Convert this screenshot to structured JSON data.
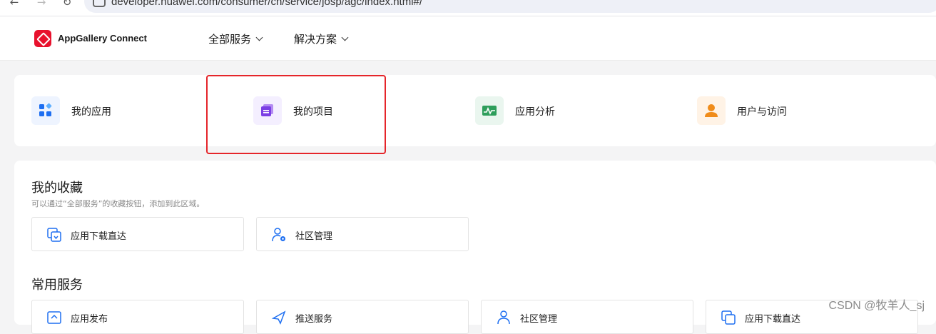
{
  "browser": {
    "back_glyph": "←",
    "forward_glyph": "→",
    "reload_glyph": "↻",
    "url": "developer.huawei.com/consumer/cn/service/josp/agc/index.html#/"
  },
  "header": {
    "brand": "AppGallery Connect",
    "nav": [
      {
        "label": "全部服务"
      },
      {
        "label": "解决方案"
      }
    ]
  },
  "quick_links": [
    {
      "label": "我的应用",
      "icon": "apps-grid-icon",
      "color": "#1e6ff1",
      "bg": "#eef4ff"
    },
    {
      "label": "我的项目",
      "icon": "project-stack-icon",
      "color": "#7b3fe4",
      "bg": "#f4efff"
    },
    {
      "label": "应用分析",
      "icon": "analytics-chart-icon",
      "color": "#2e9e5b",
      "bg": "#eaf6ef"
    },
    {
      "label": "用户与访问",
      "icon": "user-person-icon",
      "color": "#f08c1a",
      "bg": "#fff3e6"
    }
  ],
  "favorites": {
    "title": "我的收藏",
    "hint": "可以通过“全部服务”的收藏按钮，添加到此区域。",
    "items": [
      {
        "label": "应用下载直达",
        "icon": "download-direct-icon"
      },
      {
        "label": "社区管理",
        "icon": "community-admin-icon"
      }
    ]
  },
  "common_services": {
    "title": "常用服务",
    "items": [
      {
        "label": "应用发布",
        "icon": "publish-icon"
      },
      {
        "label": "推送服务",
        "icon": "push-icon"
      },
      {
        "label": "社区管理",
        "icon": "community-admin-icon"
      },
      {
        "label": "应用下载直达",
        "icon": "download-direct-icon"
      }
    ]
  },
  "highlight_color": "#e5252a",
  "watermark": "CSDN @牧羊人_sj"
}
